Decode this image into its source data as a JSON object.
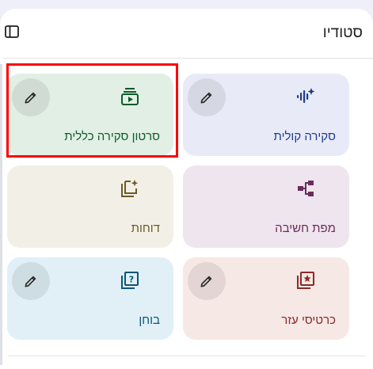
{
  "studio": {
    "title": "סטודיו"
  },
  "cards": [
    {
      "id": "audio-overview",
      "label": "סקירה קולית",
      "icon": "audio-sparkle-icon",
      "has_edit": true,
      "bg": "#e8ebf7",
      "fg": "#1f3a8a"
    },
    {
      "id": "video-overview",
      "label": "סרטון סקירה כללית",
      "icon": "video-stack-icon",
      "has_edit": true,
      "bg": "#e2efe5",
      "fg": "#0d5b2a"
    },
    {
      "id": "mind-map",
      "label": "מפת חשיבה",
      "icon": "mind-map-icon",
      "has_edit": false,
      "bg": "#efe5ee",
      "fg": "#6a2c5b"
    },
    {
      "id": "reports",
      "label": "דוחות",
      "icon": "reports-sparkle-icon",
      "has_edit": false,
      "bg": "#f2f0e6",
      "fg": "#6b5a24"
    },
    {
      "id": "flashcards",
      "label": "כרטיסי עזר",
      "icon": "flashcards-icon",
      "has_edit": true,
      "bg": "#f6e8e5",
      "fg": "#8a2a2a"
    },
    {
      "id": "quiz",
      "label": "בוחן",
      "icon": "quiz-icon",
      "has_edit": true,
      "bg": "#e0f0f6",
      "fg": "#0b5576"
    }
  ],
  "colors": {
    "page_bg": "#eeeff8",
    "panel_bg": "#ffffff",
    "highlight": "#ff0000"
  }
}
